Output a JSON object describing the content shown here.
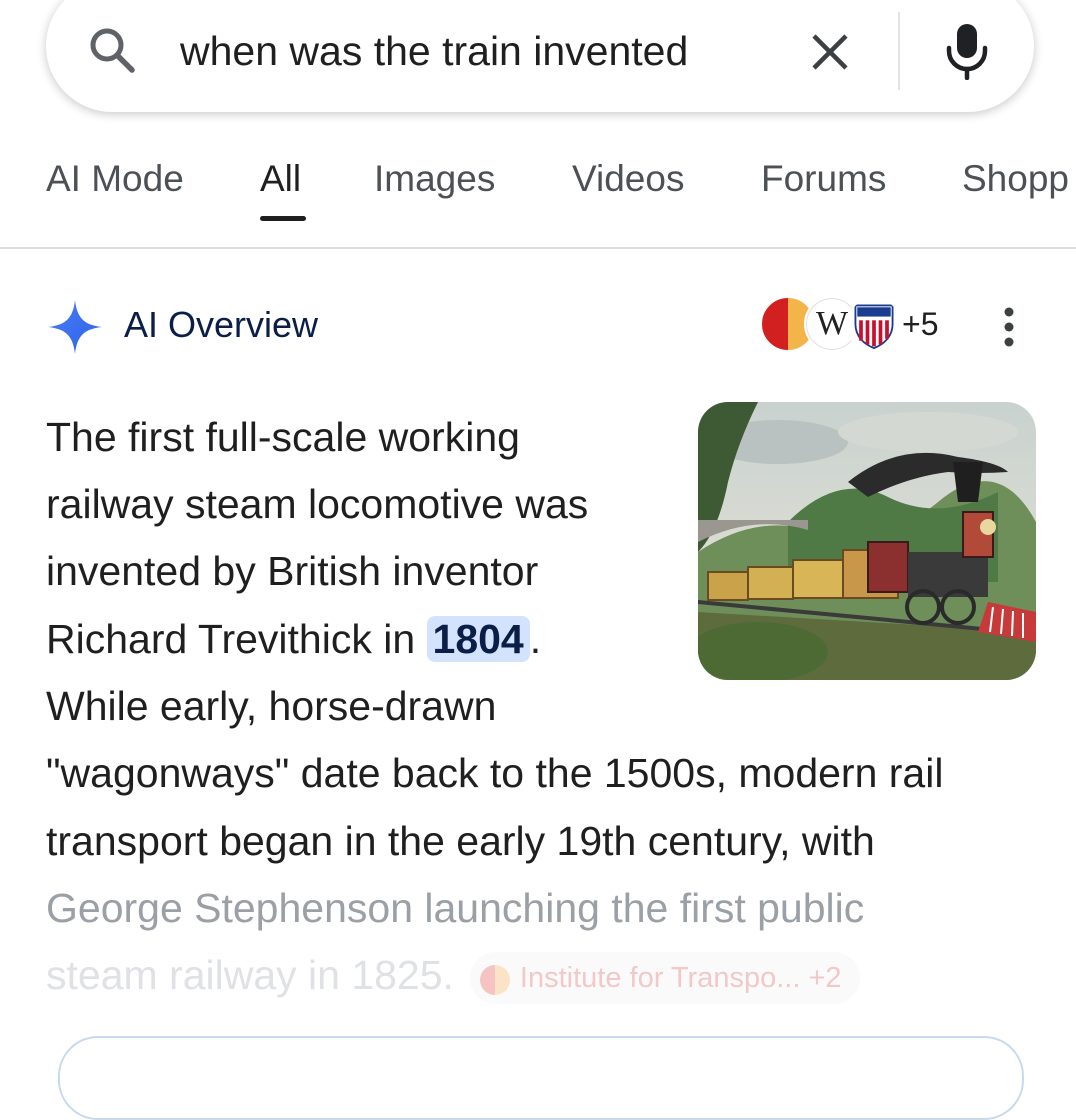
{
  "search": {
    "query": "when was the train invented"
  },
  "tabs": [
    {
      "label": "AI Mode"
    },
    {
      "label": "All"
    },
    {
      "label": "Images"
    },
    {
      "label": "Videos"
    },
    {
      "label": "Forums"
    },
    {
      "label": "Shopp"
    }
  ],
  "overview": {
    "title": "AI Overview",
    "more_sources": "+5",
    "lines": [
      "The first full-scale working",
      "railway steam locomotive was",
      "invented by British inventor",
      "Richard Trevithick in ",
      "While early, horse-drawn",
      "\"wagonways\" date back to the 1500s, modern rail",
      "transport began in the early 19th century, with",
      "George Stephenson launching the first public",
      "steam railway in 1825."
    ],
    "highlight_year": "1804",
    "period": ".",
    "citation": {
      "label": "Institute for Transpo...",
      "count": "+2"
    }
  },
  "colors": {
    "accent": "#4285f4",
    "highlight": "#d3e3fd",
    "title_text": "#0b1e48"
  }
}
